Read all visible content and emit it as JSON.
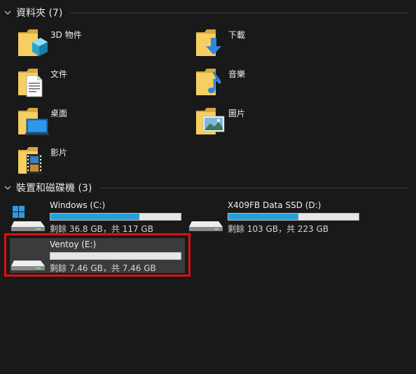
{
  "folders_section": {
    "title": "資料夾 (7)",
    "items": [
      {
        "label": "3D 物件",
        "icon": "folder-3d-objects-icon"
      },
      {
        "label": "下載",
        "icon": "folder-downloads-icon"
      },
      {
        "label": "文件",
        "icon": "folder-documents-icon"
      },
      {
        "label": "音樂",
        "icon": "folder-music-icon"
      },
      {
        "label": "桌面",
        "icon": "folder-desktop-icon"
      },
      {
        "label": "圖片",
        "icon": "folder-pictures-icon"
      },
      {
        "label": "影片",
        "icon": "folder-videos-icon"
      }
    ]
  },
  "drives_section": {
    "title": "裝置和磁碟機 (3)",
    "items": [
      {
        "name": "Windows (C:)",
        "free_text": "剩餘 36.8 GB，共 117 GB",
        "used_fraction": 0.685,
        "icon": "windows-drive-icon"
      },
      {
        "name": "X409FB Data SSD (D:)",
        "free_text": "剩餘 103 GB，共 223 GB",
        "used_fraction": 0.54,
        "icon": "hard-drive-icon"
      },
      {
        "name": "Ventoy (E:)",
        "free_text": "剩餘 7.46 GB，共 7.46 GB",
        "used_fraction": 0.0,
        "icon": "hard-drive-icon",
        "selected": true
      }
    ]
  },
  "colors": {
    "background": "#191919",
    "bar_fill": "#26a0da",
    "bar_track": "#e6e6e6",
    "highlight": "#e01010",
    "selected_bg": "#3b3b3b"
  }
}
